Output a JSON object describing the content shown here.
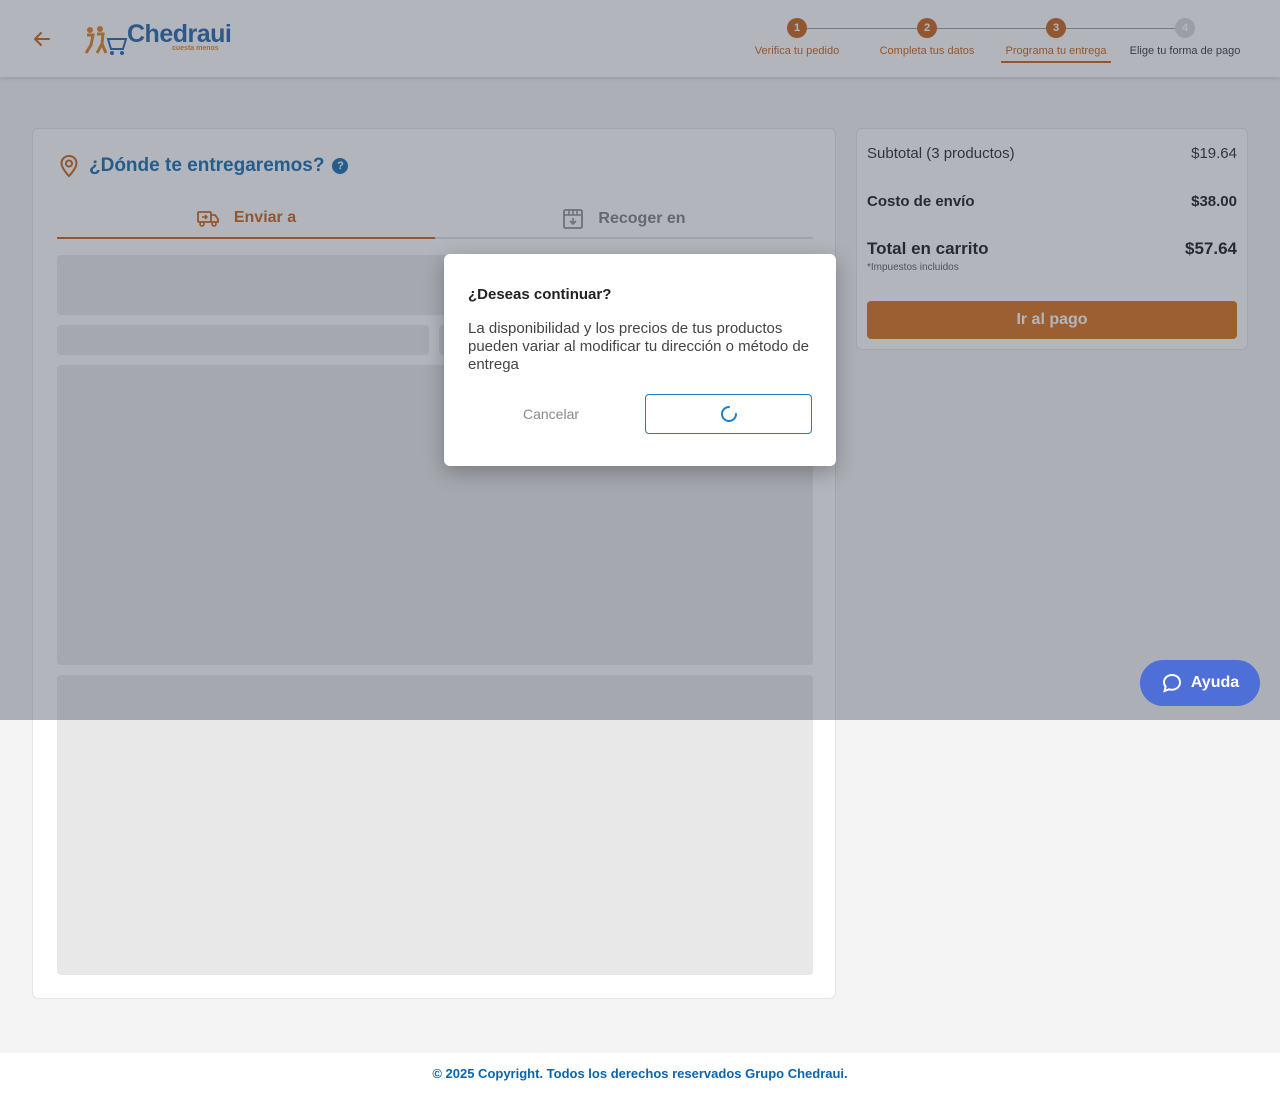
{
  "header": {
    "brand": "Chedraui",
    "tagline": "cuesta menos",
    "steps": [
      {
        "number": "1",
        "label": "Verifica tu pedido"
      },
      {
        "number": "2",
        "label": "Completa tus datos"
      },
      {
        "number": "3",
        "label": "Programa tu entrega"
      },
      {
        "number": "4",
        "label": "Elige tu forma de pago"
      }
    ]
  },
  "delivery": {
    "title": "¿Dónde te entregaremos?",
    "tabs": [
      {
        "label": "Enviar a"
      },
      {
        "label": "Recoger en"
      }
    ]
  },
  "summary": {
    "subtotal_label": "Subtotal (3 productos)",
    "subtotal_value": "$19.64",
    "shipping_label": "Costo de envío",
    "shipping_value": "$38.00",
    "total_label": "Total en carrito",
    "total_value": "$57.64",
    "taxes_note": "*Impuestos incluidos",
    "pay_button": "Ir al pago"
  },
  "modal": {
    "title": "¿Deseas continuar?",
    "body": "La disponibilidad y los precios de tus productos pueden variar al modificar tu dirección o método de entrega",
    "cancel_label": "Cancelar"
  },
  "help": {
    "label": "Ayuda"
  },
  "footer": {
    "copyright": "© 2025 Copyright. Todos los derechos reservados Grupo Chedraui."
  },
  "colors": {
    "accent": "#c95a0e",
    "brand_blue": "#0b65ad",
    "help_blue": "#4f6fd8"
  }
}
